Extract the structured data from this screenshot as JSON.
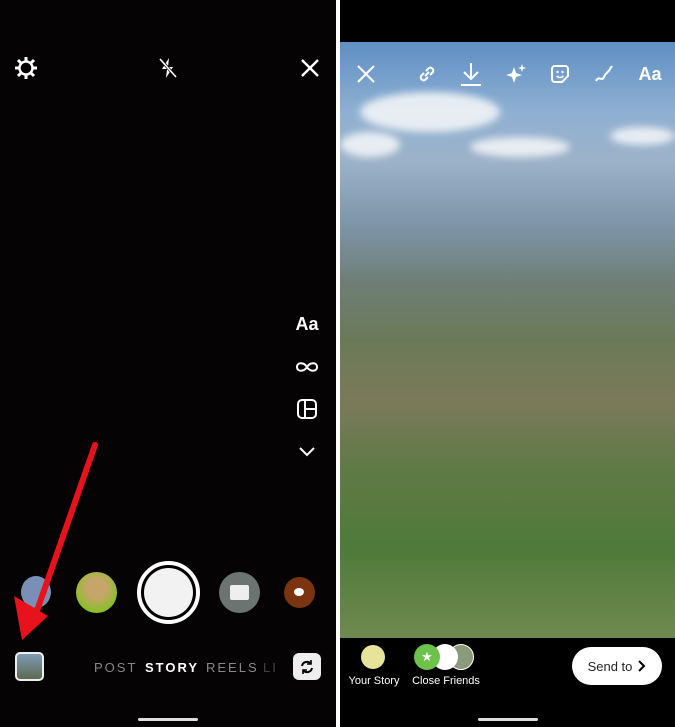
{
  "camera": {
    "top_icons": [
      "settings-gear-icon",
      "flash-off-icon",
      "close-icon"
    ],
    "side_tools": {
      "text_label": "Aa",
      "icons": [
        "infinity-boomerang-icon",
        "layout-icon",
        "chevron-down-icon"
      ]
    },
    "modes": [
      {
        "label": "POST",
        "active": false
      },
      {
        "label": "STORY",
        "active": true
      },
      {
        "label": "REELS",
        "active": false
      },
      {
        "label": "LI",
        "active": false
      }
    ],
    "annotation_color": "#e8121c"
  },
  "editor": {
    "toolbar": {
      "text_label": "Aa",
      "icons": [
        "close-icon",
        "link-icon",
        "download-icon",
        "sparkles-icon",
        "sticker-icon",
        "draw-icon"
      ]
    },
    "share": {
      "your_story": "Your Story",
      "close_friends": "Close Friends",
      "send_to": "Send to"
    },
    "close_friends_color": "#6cc24a"
  }
}
